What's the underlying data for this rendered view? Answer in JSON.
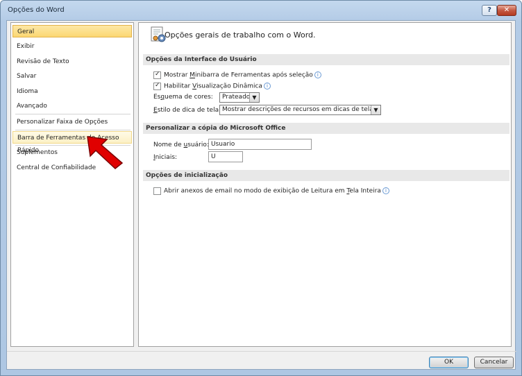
{
  "window": {
    "title": "Opções do Word"
  },
  "titlebar": {
    "help_glyph": "?",
    "close_glyph": "✕"
  },
  "sidebar": {
    "items": [
      {
        "label": "Geral"
      },
      {
        "label": "Exibir"
      },
      {
        "label": "Revisão de Texto"
      },
      {
        "label": "Salvar"
      },
      {
        "label": "Idioma"
      },
      {
        "label": "Avançado"
      },
      {
        "label": "Personalizar Faixa de Opções"
      },
      {
        "label": "Barra de Ferramentas de Acesso Rápido"
      },
      {
        "label": "Suplementos"
      },
      {
        "label": "Central de Confiabilidade"
      }
    ],
    "selected": "Geral",
    "hovered": "Barra de Ferramentas de Acesso Rápido"
  },
  "main": {
    "header": "Opções gerais de trabalho com o Word.",
    "sections": {
      "ui_options": {
        "title": "Opções da Interface do Usuário",
        "minibar": {
          "pre": "Mostrar ",
          "ul": "M",
          "post": "inibarra de Ferramentas após seleção",
          "checked": true
        },
        "livepreview": {
          "pre": "Habilitar ",
          "ul": "V",
          "post": "isualização Dinâmica",
          "checked": true
        },
        "color_scheme": {
          "pre": "Es",
          "ul": "q",
          "post": "uema de cores:",
          "value": "Prateado"
        },
        "tooltip_style": {
          "ul": "E",
          "post": "stilo de dica de tela:",
          "value": "Mostrar descrições de recursos em dicas de tela"
        }
      },
      "personalize": {
        "title": "Personalizar a cópia do Microsoft Office",
        "username": {
          "pre": "Nome de ",
          "ul": "u",
          "post": "suário:",
          "value": "Usuario"
        },
        "initials": {
          "ul": "I",
          "post": "niciais:",
          "value": "U"
        }
      },
      "startup": {
        "title": "Opções de inicialização",
        "email_attach": {
          "pre": "Abrir anexos de email no modo de exibição de Leitura em ",
          "ul": "T",
          "post": "ela Inteira",
          "checked": false
        }
      }
    }
  },
  "footer": {
    "ok": "OK",
    "cancel": "Cancelar"
  },
  "colors": {
    "selected_bg": "#fbd772",
    "annotation_arrow": "#e00000",
    "section_bg": "#e8e8e8"
  },
  "icons": {
    "header": "general-options-icon",
    "info": "info-icon",
    "arrow": "red-pointer-arrow"
  },
  "info_glyph": "i",
  "dropdown_glyph": "▼"
}
